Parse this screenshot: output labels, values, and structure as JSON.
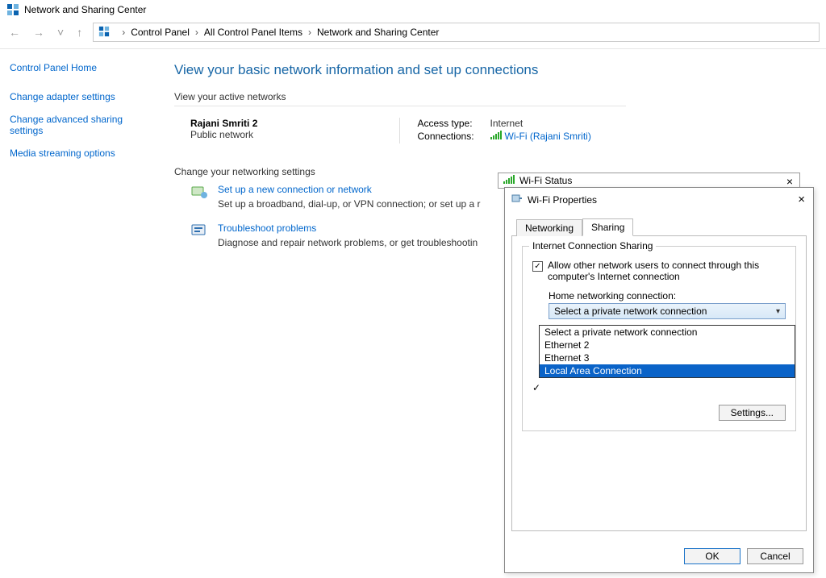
{
  "titlebar": {
    "title": "Network and Sharing Center"
  },
  "breadcrumb": {
    "items": [
      "Control Panel",
      "All Control Panel Items",
      "Network and Sharing Center"
    ]
  },
  "sidebar": {
    "home": "Control Panel Home",
    "links": [
      "Change adapter settings",
      "Change advanced sharing settings",
      "Media streaming options"
    ]
  },
  "content": {
    "pagetitle": "View your basic network information and set up connections",
    "active_head": "View your active networks",
    "network": {
      "name": "Rajani Smriti 2",
      "type": "Public network",
      "access_label": "Access type:",
      "access_value": "Internet",
      "conn_label": "Connections:",
      "conn_value": "Wi-Fi (Rajani Smriti)"
    },
    "change_head": "Change your networking settings",
    "action1": {
      "title": "Set up a new connection or network",
      "desc": "Set up a broadband, dial-up, or VPN connection; or set up a r"
    },
    "action2": {
      "title": "Troubleshoot problems",
      "desc": "Diagnose and repair network problems, or get troubleshootin"
    }
  },
  "status_win": {
    "title": "Wi-Fi Status"
  },
  "props_win": {
    "title": "Wi-Fi Properties",
    "tabs": {
      "networking": "Networking",
      "sharing": "Sharing"
    },
    "group_title": "Internet Connection Sharing",
    "allow_checkbox": "Allow other network users to connect through this computer's Internet connection",
    "home_label": "Home networking connection:",
    "combo_value": "Select a private network connection",
    "dropdown": [
      "Select a private network connection",
      "Ethernet 2",
      "Ethernet 3",
      "Local Area Connection"
    ],
    "settings_btn": "Settings...",
    "ok": "OK",
    "cancel": "Cancel"
  }
}
